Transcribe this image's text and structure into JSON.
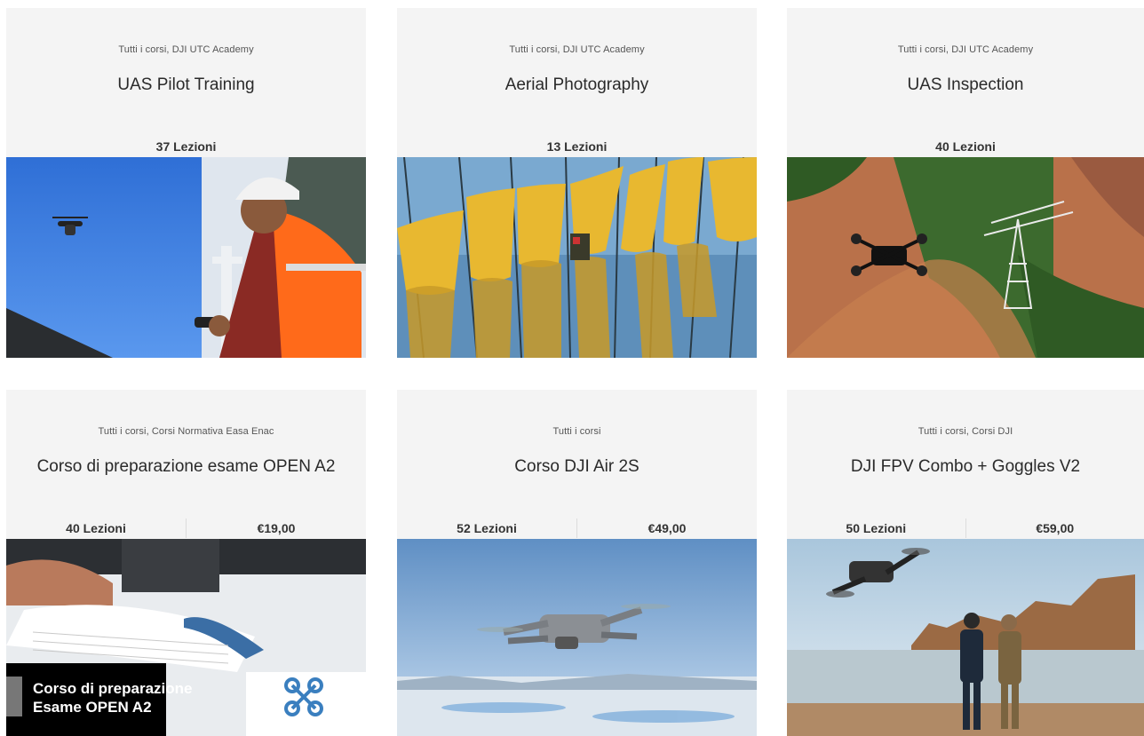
{
  "courses": [
    {
      "categories": "Tutti i corsi, DJI UTC Academy",
      "title": "UAS Pilot Training",
      "lessons": "37 Lezioni"
    },
    {
      "categories": "Tutti i corsi, DJI UTC Academy",
      "title": "Aerial Photography",
      "lessons": "13 Lezioni"
    },
    {
      "categories": "Tutti i corsi, DJI UTC Academy",
      "title": "UAS Inspection",
      "lessons": "40 Lezioni"
    },
    {
      "categories": "Tutti i corsi, Corsi Normativa Easa Enac",
      "title": "Corso di preparazione esame OPEN A2",
      "lessons": "40 Lezioni",
      "price": "€19,00",
      "image_text": [
        "Corso di preparazione",
        "Esame OPEN A2"
      ]
    },
    {
      "categories": "Tutti i corsi",
      "title": "Corso DJI Air 2S",
      "lessons": "52 Lezioni",
      "price": "€49,00"
    },
    {
      "categories": "Tutti i corsi, Corsi DJI",
      "title": "DJI FPV Combo + Goggles V2",
      "lessons": "50 Lezioni",
      "price": "€59,00"
    }
  ],
  "colors": {
    "card_bg": "#f4f4f4",
    "text": "#2a2a2a",
    "muted": "#555555"
  }
}
